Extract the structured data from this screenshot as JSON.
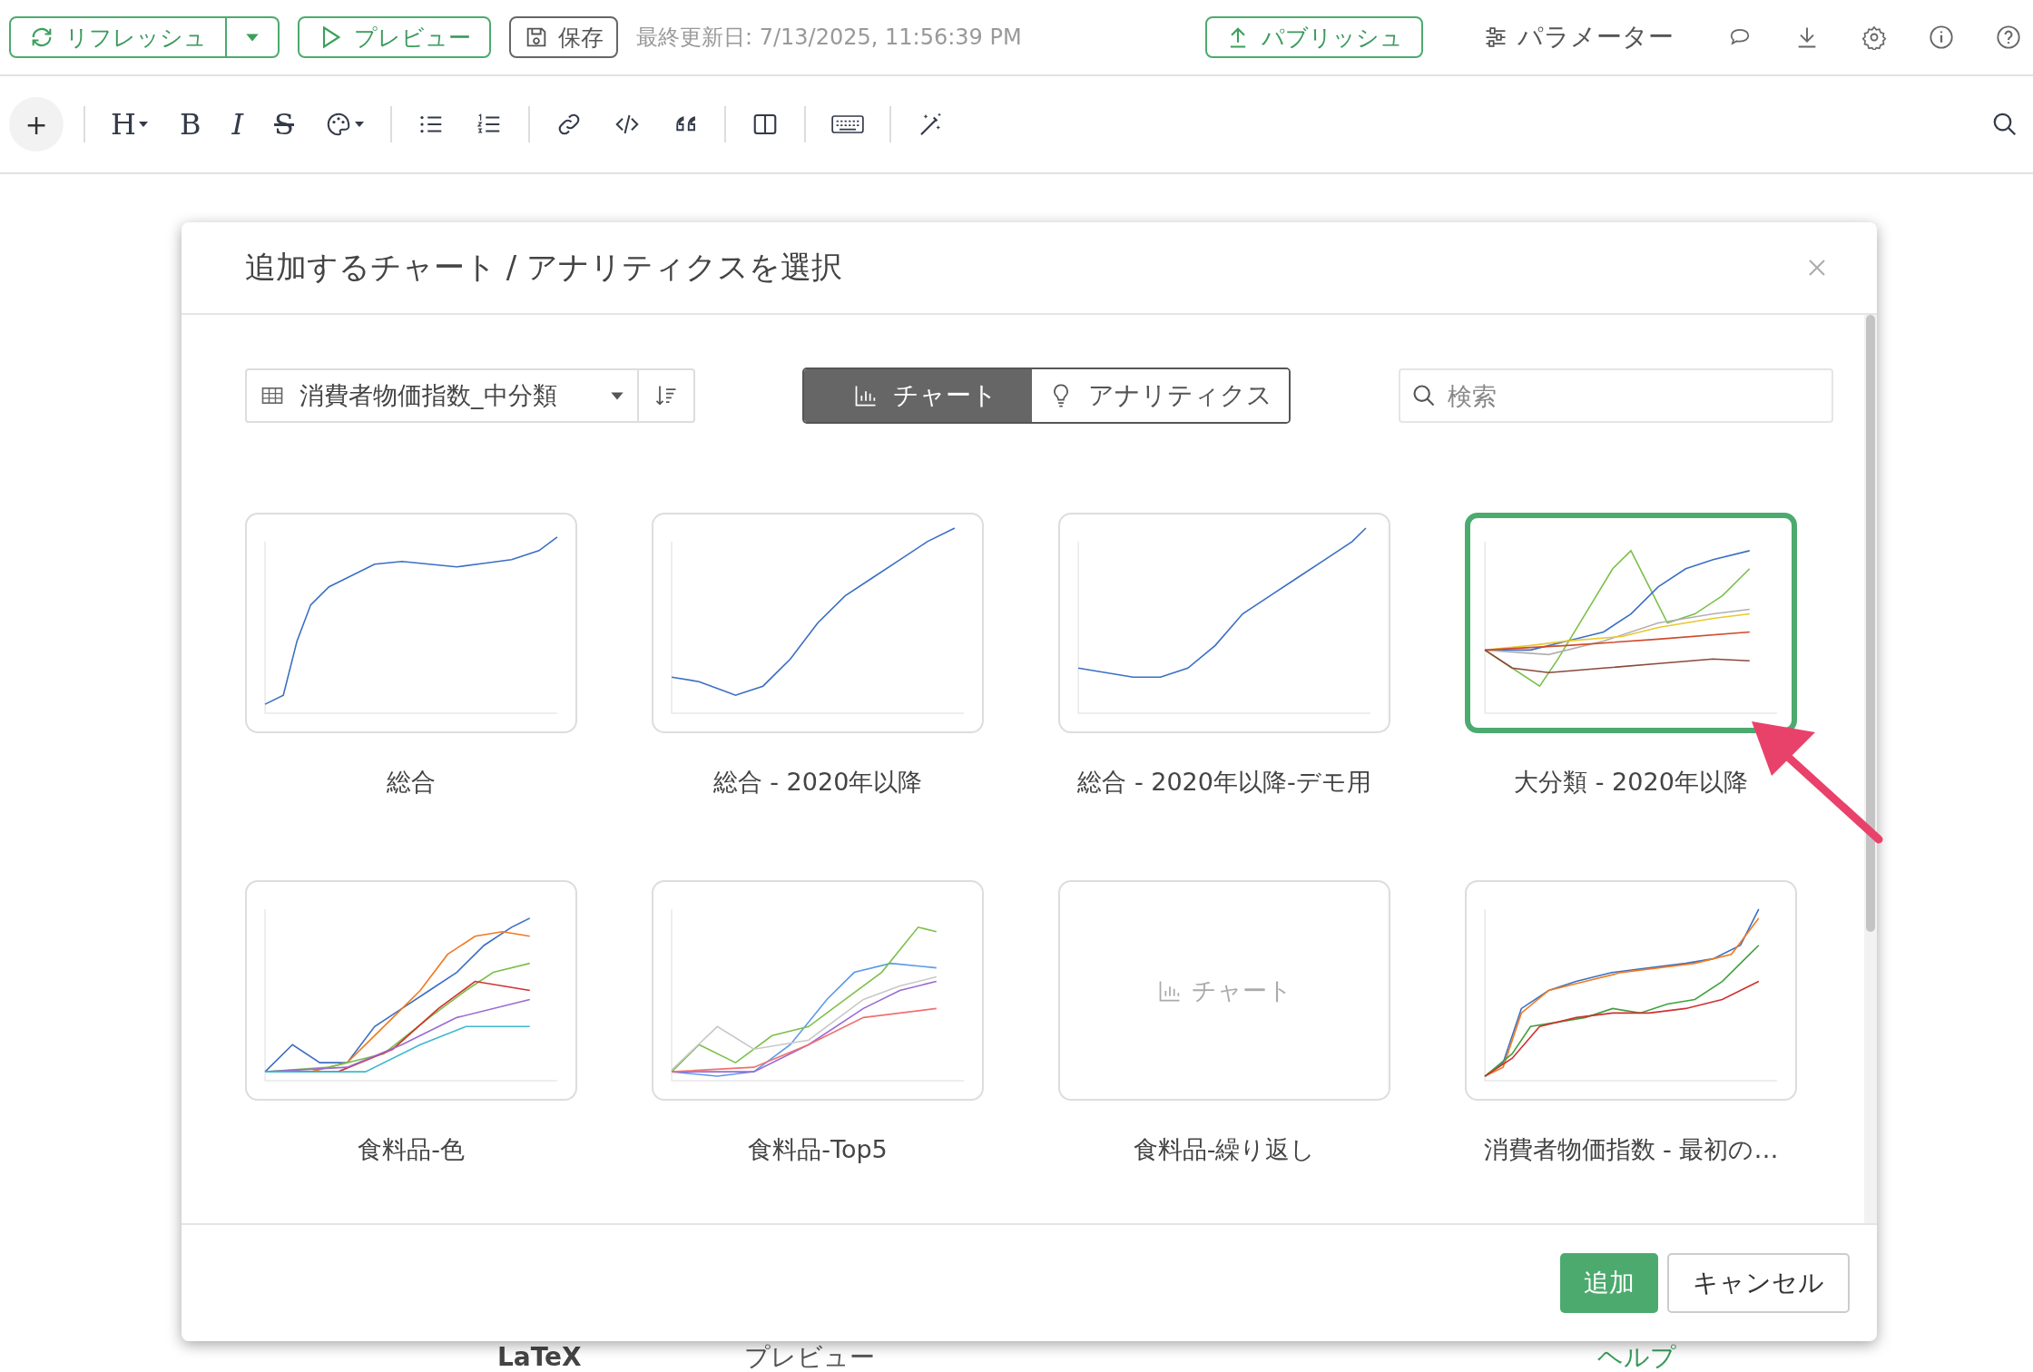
{
  "top_bar": {
    "refresh": "リフレッシュ",
    "preview": "プレビュー",
    "save": "保存",
    "last_updated": "最終更新日: 7/13/2025, 11:56:39 PM",
    "publish": "パブリッシュ",
    "parameters": "パラメーター"
  },
  "editor_toolbar": {
    "add": "+",
    "heading": "H",
    "bold": "B",
    "italic": "I",
    "strike": "S"
  },
  "background_text": [
    {
      "text": "LaTeX",
      "kind": "bold"
    },
    {
      "text": "プレビュー",
      "kind": "plain"
    },
    {
      "text": "ヘルプ",
      "kind": "link"
    }
  ],
  "dialog": {
    "title": "追加するチャート / アナリティクスを選択",
    "data_source": "消費者物価指数_中分類",
    "tabs": [
      {
        "label": "チャート",
        "selected": true
      },
      {
        "label": "アナリティクス",
        "selected": false
      }
    ],
    "search": {
      "placeholder": "検索"
    },
    "items": [
      {
        "label": "総合",
        "selected": false
      },
      {
        "label": "総合 - 2020年以降",
        "selected": false
      },
      {
        "label": "総合 - 2020年以降-デモ用",
        "selected": false
      },
      {
        "label": "大分類 - 2020年以降",
        "selected": true
      },
      {
        "label": "食料品-色",
        "selected": false
      },
      {
        "label": "食料品-Top5",
        "selected": false
      },
      {
        "label": "食料品-繰り返し",
        "placeholder_text": "チャート",
        "selected": false
      },
      {
        "label": "消費者物価指数 - 最初の…",
        "selected": false
      }
    ],
    "buttons": {
      "add": "追加",
      "cancel": "キャンセル"
    }
  }
}
